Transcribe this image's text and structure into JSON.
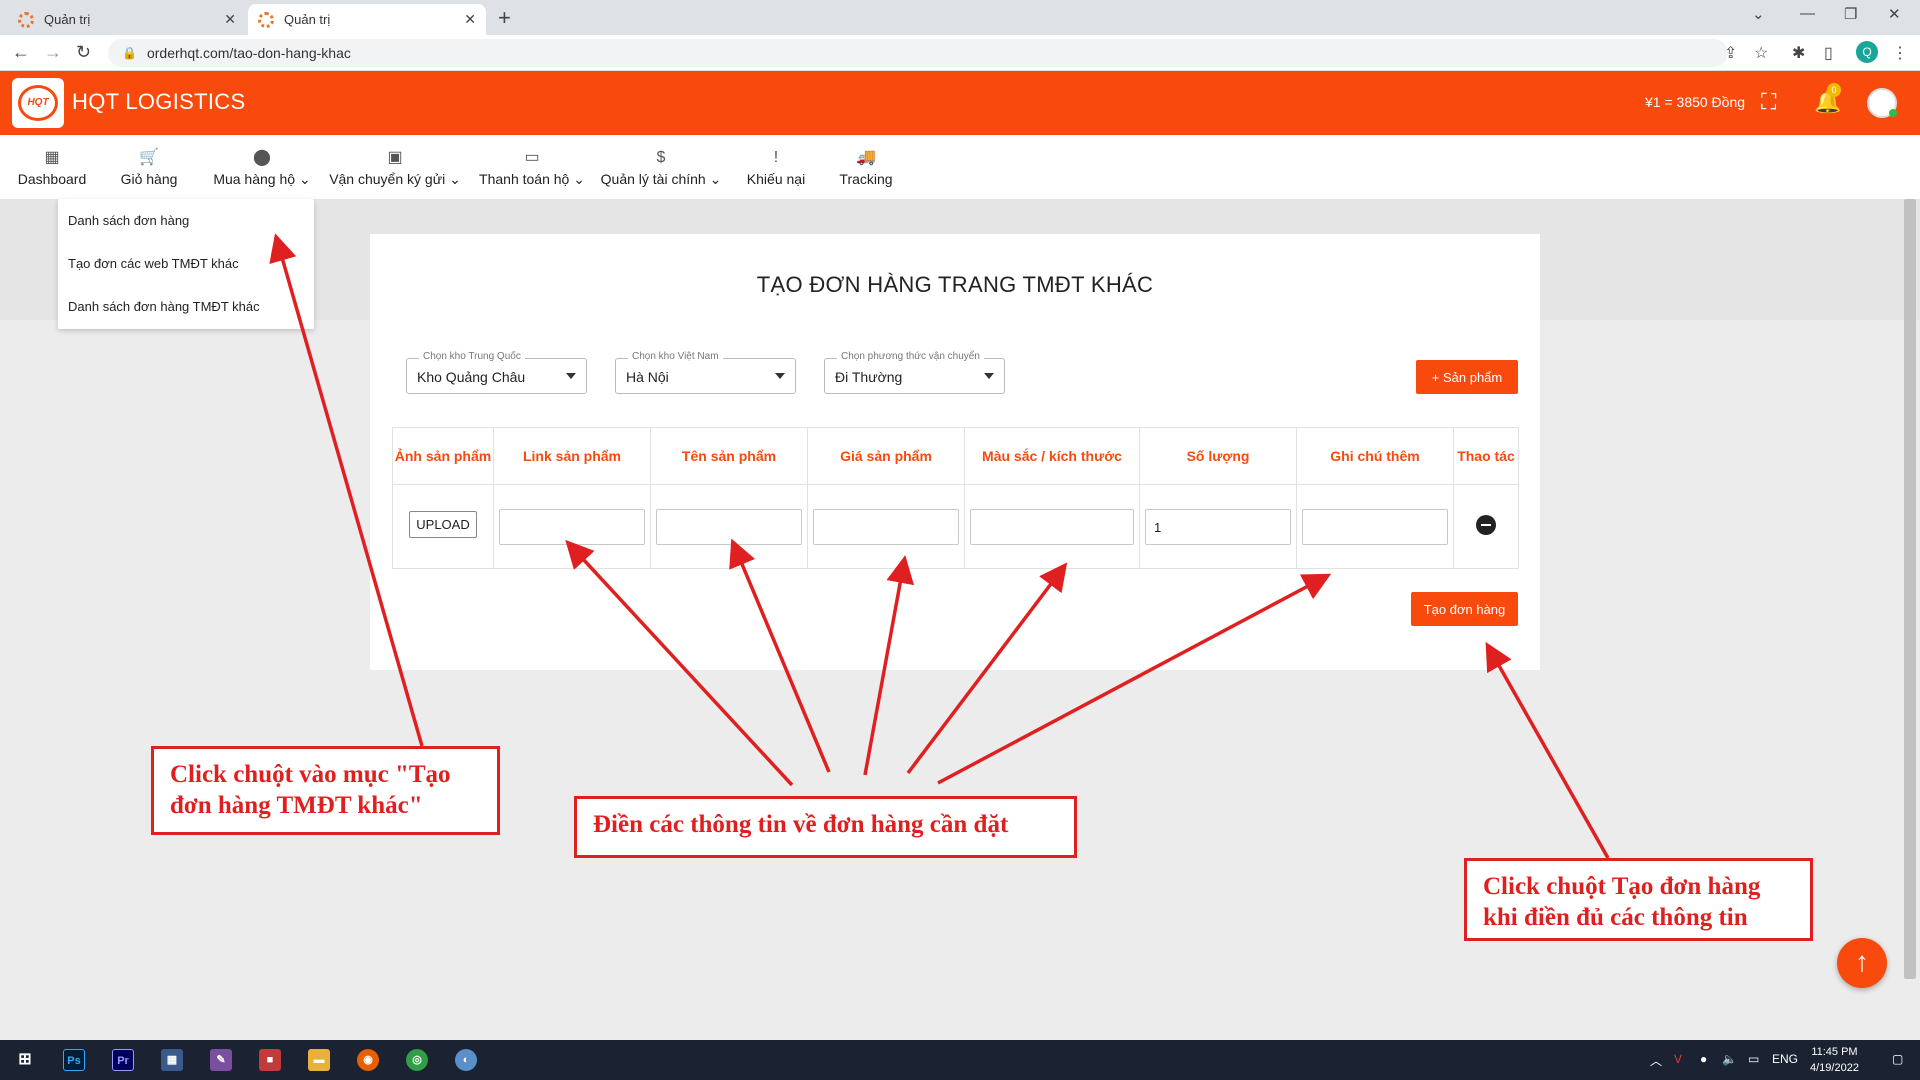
{
  "browser": {
    "tabs": [
      {
        "title": "Quản trị",
        "close": "✕"
      },
      {
        "title": "Quản trị",
        "close": "✕"
      }
    ],
    "new_tab": "+",
    "url": "orderhqt.com/tao-don-hang-khac",
    "profile_initial": "Q"
  },
  "header": {
    "logo_text": "HQT",
    "brand": "HQT LOGISTICS",
    "exchange_rate": "¥1 = 3850 Đồng",
    "notification_count": "0"
  },
  "menu": [
    {
      "label": "Dashboard",
      "icon": "dashboard-icon",
      "glyph": "▦"
    },
    {
      "label": "Giỏ hàng",
      "icon": "cart-icon",
      "glyph": "🛒"
    },
    {
      "label": "Mua hàng hộ",
      "icon": "buy-icon",
      "glyph": "⬤",
      "caret": "⌄"
    },
    {
      "label": "Vận chuyển ký gửi",
      "icon": "shipping-icon",
      "glyph": "▣",
      "caret": "⌄"
    },
    {
      "label": "Thanh toán hộ",
      "icon": "card-icon",
      "glyph": "▭",
      "caret": "⌄"
    },
    {
      "label": "Quản lý tài chính",
      "icon": "dollar-icon",
      "glyph": "$",
      "caret": "⌄"
    },
    {
      "label": "Khiếu nại",
      "icon": "alert-icon",
      "glyph": "!"
    },
    {
      "label": "Tracking",
      "icon": "truck-icon",
      "glyph": "🚚"
    }
  ],
  "dropdown": [
    "Danh sách đơn hàng",
    "Tạo đơn các web TMĐT khác",
    "Danh sách đơn hàng TMĐT khác"
  ],
  "page": {
    "title": "TẠO ĐƠN HÀNG TRANG TMĐT KHÁC",
    "selects": [
      {
        "legend": "Chọn kho Trung Quốc",
        "value": "Kho Quảng Châu"
      },
      {
        "legend": "Chọn kho Việt Nam",
        "value": "Hà Nội"
      },
      {
        "legend": "Chọn phương thức vận chuyển",
        "value": "Đi Thường"
      }
    ],
    "add_product": "+ Sản phẩm",
    "table": {
      "headers": [
        "Ảnh sản phẩm",
        "Link sản phẩm",
        "Tên sản phẩm",
        "Giá sản phẩm",
        "Màu sắc / kích thước",
        "Số lượng",
        "Ghi chú thêm",
        "Thao tác"
      ],
      "row": {
        "upload": "UPLOAD",
        "link": "",
        "name": "",
        "price": "",
        "variant": "",
        "quantity": "1",
        "note": ""
      }
    },
    "create_order": "Tạo đơn hàng"
  },
  "annotations": {
    "menu_hint": "Click chuột vào mục \"Tạo đơn hàng TMĐT khác\"",
    "fill_hint": "Điền các thông tin về đơn hàng cần đặt",
    "submit_hint": "Click chuột Tạo đơn hàng khi điền đủ các thông tin",
    "color": "#e02020"
  },
  "taskbar": {
    "lang": "ENG",
    "time": "11:45 PM",
    "date": "4/19/2022"
  },
  "colors": {
    "brand": "#f74a0c"
  }
}
